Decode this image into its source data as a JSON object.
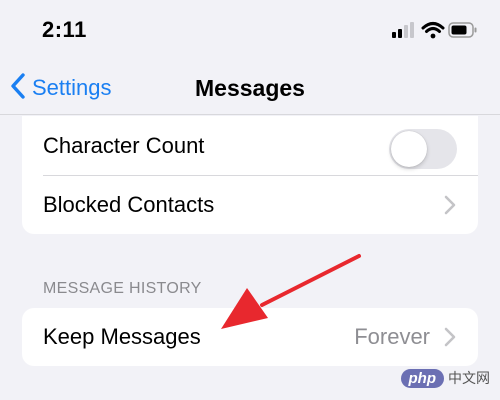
{
  "status_bar": {
    "time": "2:11",
    "icons": [
      "cellular-signal-icon",
      "wifi-icon",
      "battery-icon"
    ]
  },
  "nav_bar": {
    "back_label": "Settings",
    "title": "Messages",
    "accent_color": "#1a7ff2"
  },
  "settings_group_1": {
    "items": [
      {
        "label": "Character Count",
        "control": "toggle",
        "enabled": false
      },
      {
        "label": "Blocked Contacts",
        "control": "chevron"
      }
    ]
  },
  "message_history": {
    "header": "MESSAGE HISTORY",
    "items": [
      {
        "label": "Keep Messages",
        "value": "Forever",
        "control": "chevron"
      }
    ]
  },
  "annotation": {
    "type": "red-arrow",
    "color": "#e8282e",
    "points_to": "Keep Messages"
  },
  "watermark": {
    "logo": "php",
    "text": "中文网"
  }
}
